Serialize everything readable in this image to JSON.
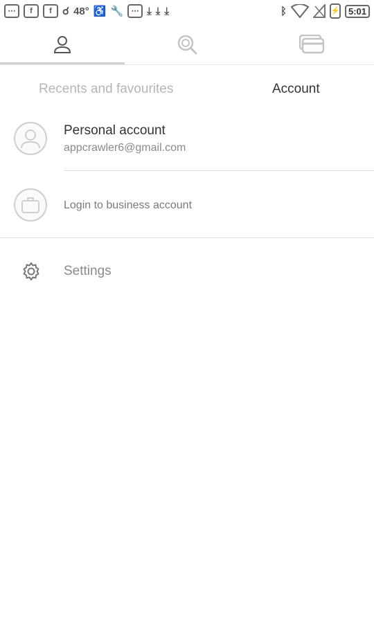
{
  "status_bar": {
    "left_icons": [
      "chat-icon",
      "facebook-icon",
      "facebook-icon",
      "notification-icon",
      "weather-icon",
      "accessibility-icon",
      "wrench-icon",
      "messenger-icon",
      "download-icon",
      "download-icon",
      "download-icon"
    ],
    "temperature": "48°",
    "right_icons": [
      "bluetooth-icon",
      "wifi-icon",
      "signal-icon",
      "battery-icon"
    ],
    "time": "5:01"
  },
  "top_tabs": [
    {
      "icon": "person-icon",
      "selected": true
    },
    {
      "icon": "search-history-icon",
      "selected": false
    },
    {
      "icon": "cards-icon",
      "selected": false
    }
  ],
  "sub_tabs": {
    "left": "Recents and favourites",
    "right": "Account"
  },
  "personal_account": {
    "title": "Personal account",
    "email": "appcrawler6@gmail.com"
  },
  "business_account": {
    "label": "Login to business account"
  },
  "settings": {
    "label": "Settings"
  },
  "colors": {
    "indicator": "#cfcfcf",
    "text_primary": "#333333",
    "text_secondary": "#8a8a8a",
    "text_muted": "#b6b6b6"
  }
}
